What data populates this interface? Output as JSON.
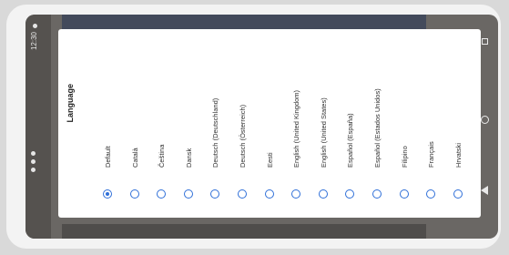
{
  "status_bar": {
    "time": "12:30",
    "icons": [
      "cell-signal-icon",
      "wifi-icon",
      "battery-icon",
      "notification-icon"
    ]
  },
  "nav_bar": {
    "icons": [
      "recents-icon",
      "home-icon",
      "back-icon"
    ]
  },
  "dialog": {
    "title": "Language",
    "options": [
      {
        "label": "Default",
        "selected": true
      },
      {
        "label": "Català",
        "selected": false
      },
      {
        "label": "Čeština",
        "selected": false
      },
      {
        "label": "Dansk",
        "selected": false
      },
      {
        "label": "Deutsch (Deutschland)",
        "selected": false
      },
      {
        "label": "Deutsch (Österreich)",
        "selected": false
      },
      {
        "label": "Eesti",
        "selected": false
      },
      {
        "label": "English (United Kingdom)",
        "selected": false
      },
      {
        "label": "English (United States)",
        "selected": false
      },
      {
        "label": "Español (España)",
        "selected": false
      },
      {
        "label": "Español (Estados Unidos)",
        "selected": false
      },
      {
        "label": "Filipino",
        "selected": false
      },
      {
        "label": "Français",
        "selected": false
      },
      {
        "label": "Hrvatski",
        "selected": false
      }
    ]
  }
}
